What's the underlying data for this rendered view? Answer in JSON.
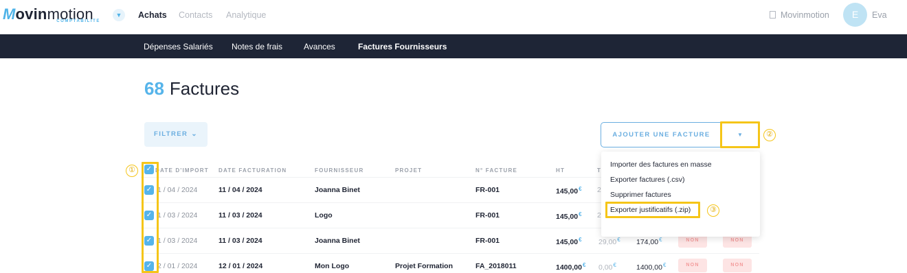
{
  "brand": {
    "logo_m": "M",
    "logo_vin": "ovin",
    "logo_motion": "motion",
    "logo_sub": "COMPTABILITE"
  },
  "topnav": {
    "switch_icon": "chevron-down-icon",
    "items": [
      "Achats",
      "Contacts",
      "Analytique"
    ],
    "active": "Achats"
  },
  "account": {
    "company": "Movinmotion",
    "avatar_initial": "E",
    "user_name": "Eva"
  },
  "subnav": {
    "items": [
      "Dépenses Salariés",
      "Notes de frais",
      "Avances",
      "Factures Fournisseurs"
    ],
    "active": "Factures Fournisseurs"
  },
  "page": {
    "count": "68",
    "title": "Factures"
  },
  "toolbar": {
    "filter_label": "FILTRER",
    "add_label": "AJOUTER UNE FACTURE"
  },
  "menu": {
    "items": [
      "Importer des factures en masse",
      "Exporter factures (.csv)",
      "Supprimer factures",
      "Exporter justificatifs (.zip)"
    ]
  },
  "annotations": [
    "①",
    "②",
    "③"
  ],
  "table": {
    "headers": [
      "DATE D'IMPORT",
      "DATE FACTURATION",
      "FOURNISSEUR",
      "PROJET",
      "N° FACTURE",
      "HT",
      "T"
    ],
    "rows": [
      {
        "import_date": "1 / 04 / 2024",
        "invoice_date": "11 / 04 / 2024",
        "supplier": "Joanna Binet",
        "project": "",
        "number": "FR-001",
        "ht": "145,00",
        "tva_partial": "2"
      },
      {
        "import_date": "1 / 03 / 2024",
        "invoice_date": "11 / 03 / 2024",
        "supplier": "Logo",
        "project": "",
        "number": "FR-001",
        "ht": "145,00",
        "tva_partial": "2"
      },
      {
        "import_date": "1 / 03 / 2024",
        "invoice_date": "11 / 03 / 2024",
        "supplier": "Joanna Binet",
        "project": "",
        "number": "FR-001",
        "ht": "145,00",
        "tva": "29,00",
        "ttc": "174,00",
        "badge1": "NON",
        "badge2": "NON"
      },
      {
        "import_date": "2 / 01 / 2024",
        "invoice_date": "12 / 01 / 2024",
        "supplier": "Mon Logo",
        "project": "Projet Formation",
        "number": "FA_2018011",
        "ht": "1400,00",
        "tva": "0,00",
        "ttc": "1400,00",
        "badge1": "NON",
        "badge2": "NON"
      }
    ],
    "currency_symbol": "€",
    "check_glyph": "✓"
  },
  "colors": {
    "accent": "#56b4ea",
    "dark_nav": "#1e2536",
    "highlight": "#f5c518",
    "badge_bg": "#fde4e4"
  }
}
